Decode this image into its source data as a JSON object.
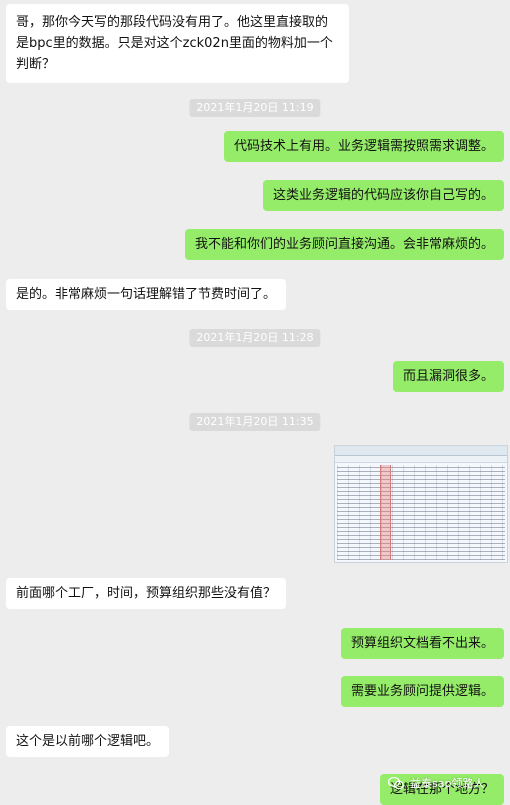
{
  "messages": [
    {
      "text": "哥，那你今天写的那段代码没有用了。他这里直接取的是bpc里的数据。只是对这个zck02n里面的物料加一个判断？"
    },
    {
      "text": "2021年1月20日 11:19"
    },
    {
      "text": "代码技术上有用。业务逻辑需按照需求调整。"
    },
    {
      "text": "这类业务逻辑的代码应该你自己写的。"
    },
    {
      "text": "我不能和你们的业务顾问直接沟通。会非常麻烦的。"
    },
    {
      "text": "是的。非常麻烦一句话理解错了节费时间了。"
    },
    {
      "text": "2021年1月20日 11:28"
    },
    {
      "text": "而且漏洞很多。"
    },
    {
      "text": "2021年1月20日 11:35"
    },
    {
      "text": "前面哪个工厂，时间，预算组织那些没有值？"
    },
    {
      "text": "预算组织文档看不出来。"
    },
    {
      "text": "需要业务顾问提供逻辑。"
    },
    {
      "text": "这个是以前哪个逻辑吧。"
    },
    {
      "text": "逻辑在那个地方？"
    }
  ],
  "watermark": {
    "text": "益泰sap领路人"
  },
  "colors": {
    "background": "#ededed",
    "sent_bubble": "#95ec69",
    "received_bubble": "#ffffff",
    "timestamp_bg": "#dadada"
  }
}
